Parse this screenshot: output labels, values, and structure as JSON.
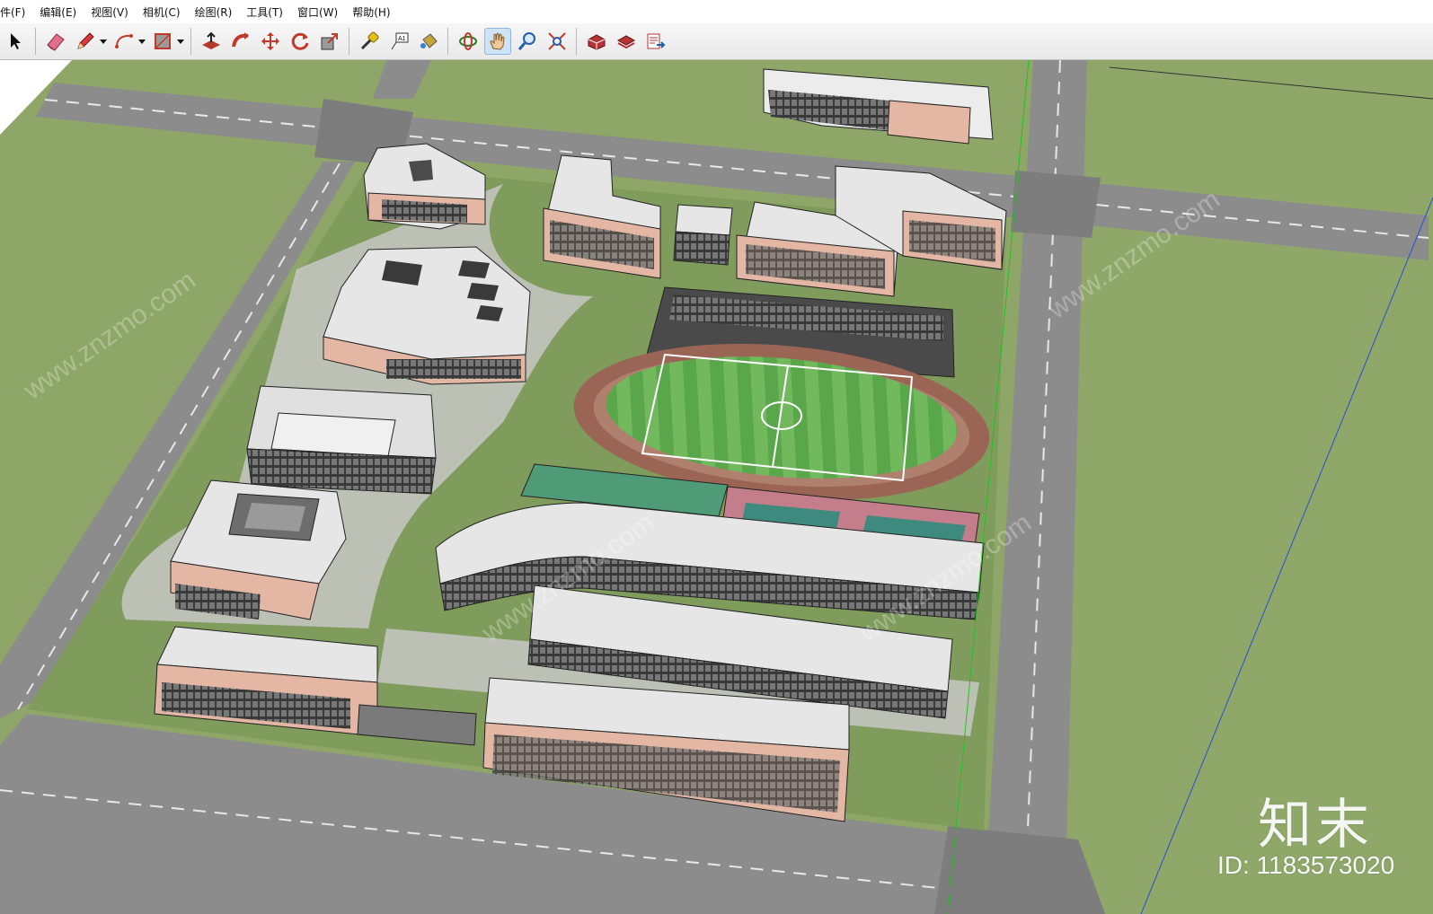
{
  "menu": [
    {
      "label": "件(F)"
    },
    {
      "label": "编辑(E)"
    },
    {
      "label": "视图(V)"
    },
    {
      "label": "相机(C)"
    },
    {
      "label": "绘图(R)"
    },
    {
      "label": "工具(T)"
    },
    {
      "label": "窗口(W)"
    },
    {
      "label": "帮助(H)"
    }
  ],
  "toolbar": [
    {
      "icon": "select-arrow-icon"
    },
    {
      "icon": "eraser-icon"
    },
    {
      "icon": "pencil-line-icon"
    },
    {
      "icon": "arc-icon"
    },
    {
      "icon": "shape-rectangle-icon"
    },
    {
      "icon": "push-pull-icon"
    },
    {
      "icon": "follow-me-icon"
    },
    {
      "icon": "move-icon"
    },
    {
      "icon": "rotate-icon"
    },
    {
      "icon": "scale-icon"
    },
    {
      "icon": "tape-measure-icon"
    },
    {
      "icon": "text-label-icon"
    },
    {
      "icon": "paint-bucket-icon"
    },
    {
      "icon": "orbit-icon"
    },
    {
      "icon": "pan-hand-icon",
      "active": true
    },
    {
      "icon": "zoom-icon"
    },
    {
      "icon": "zoom-extents-icon"
    },
    {
      "icon": "warehouse-icon"
    },
    {
      "icon": "extension-warehouse-icon"
    },
    {
      "icon": "send-to-layout-icon"
    }
  ],
  "text_label_glyph": "A1",
  "watermark": {
    "logo": "知末",
    "id": "ID: 1183573020",
    "site": "www.znzmo.com"
  },
  "colors": {
    "grass": "#8fa86a",
    "road": "#8c8c8c",
    "roof": "#e6e6e6",
    "facade": "#e3b7a4",
    "field": "#5fa84e",
    "track": "#a86f5f",
    "accent": "#cfe3f7"
  }
}
